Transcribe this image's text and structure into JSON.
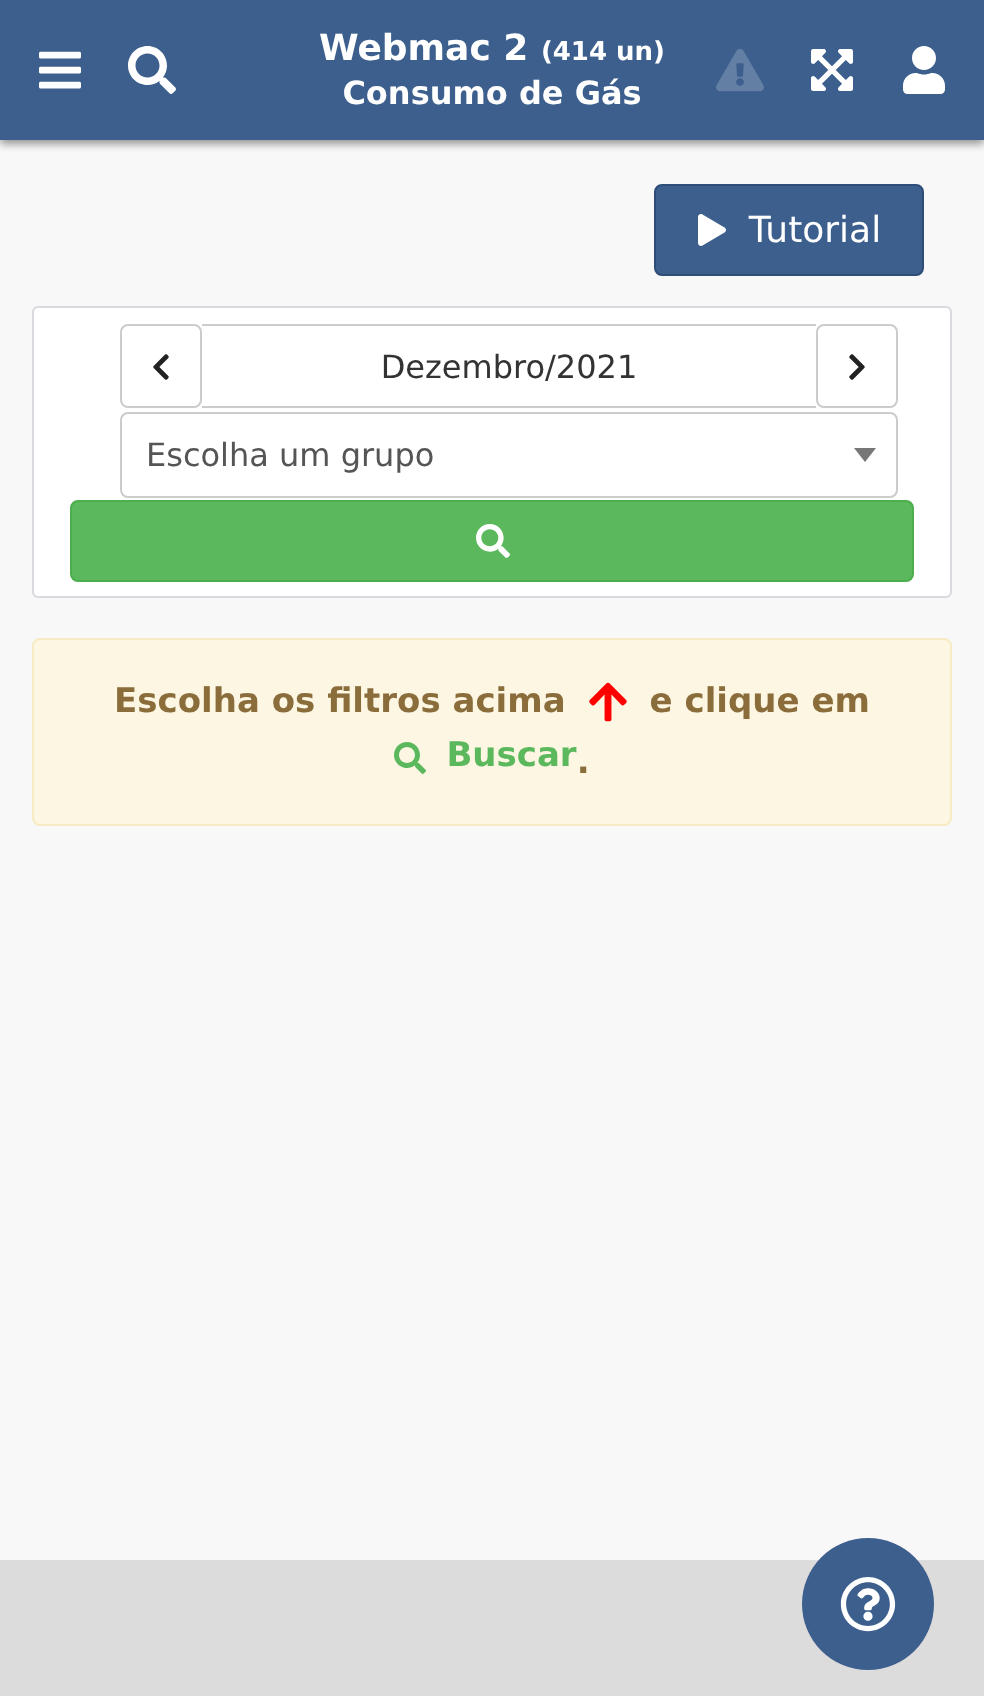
{
  "header": {
    "title": "Webmac 2",
    "count": "(414 un)",
    "subtitle": "Consumo de Gás",
    "alert_disabled": true
  },
  "tutorial_button": {
    "label": "Tutorial"
  },
  "filters": {
    "period": "Dezembro/2021",
    "group_placeholder": "Escolha um grupo"
  },
  "message": {
    "before": "Escolha os filtros acima",
    "after": "e clique em",
    "link": "Buscar",
    "end": "."
  }
}
